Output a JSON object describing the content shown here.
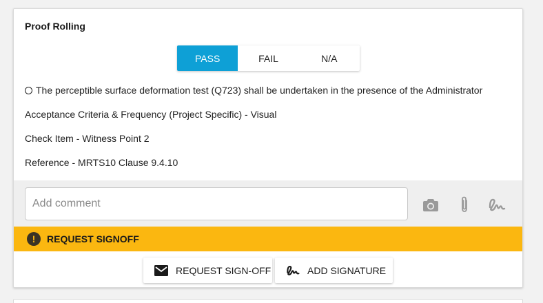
{
  "card": {
    "title": "Proof Rolling",
    "result_options": [
      {
        "label": "PASS",
        "selected": true
      },
      {
        "label": "FAIL",
        "selected": false
      },
      {
        "label": "N/A",
        "selected": false
      }
    ],
    "description": "The perceptible surface deformation test (Q723) shall be undertaken in the presence of the Administrator",
    "acceptance": "Acceptance Criteria & Frequency (Project Specific) - Visual",
    "check_item": "Check Item - Witness Point 2",
    "reference": "Reference - MRTS10 Clause 9.4.10"
  },
  "comment": {
    "placeholder": "Add comment",
    "value": "",
    "icons": [
      "camera-icon",
      "paperclip-icon",
      "signature-icon"
    ]
  },
  "warning": {
    "text": "REQUEST SIGNOFF",
    "color": "#fbb710"
  },
  "actions": {
    "request_signoff": "REQUEST SIGN-OFF",
    "add_signature": "ADD SIGNATURE"
  },
  "colors": {
    "accent": "#0ea0d6",
    "warning": "#fbb710"
  }
}
